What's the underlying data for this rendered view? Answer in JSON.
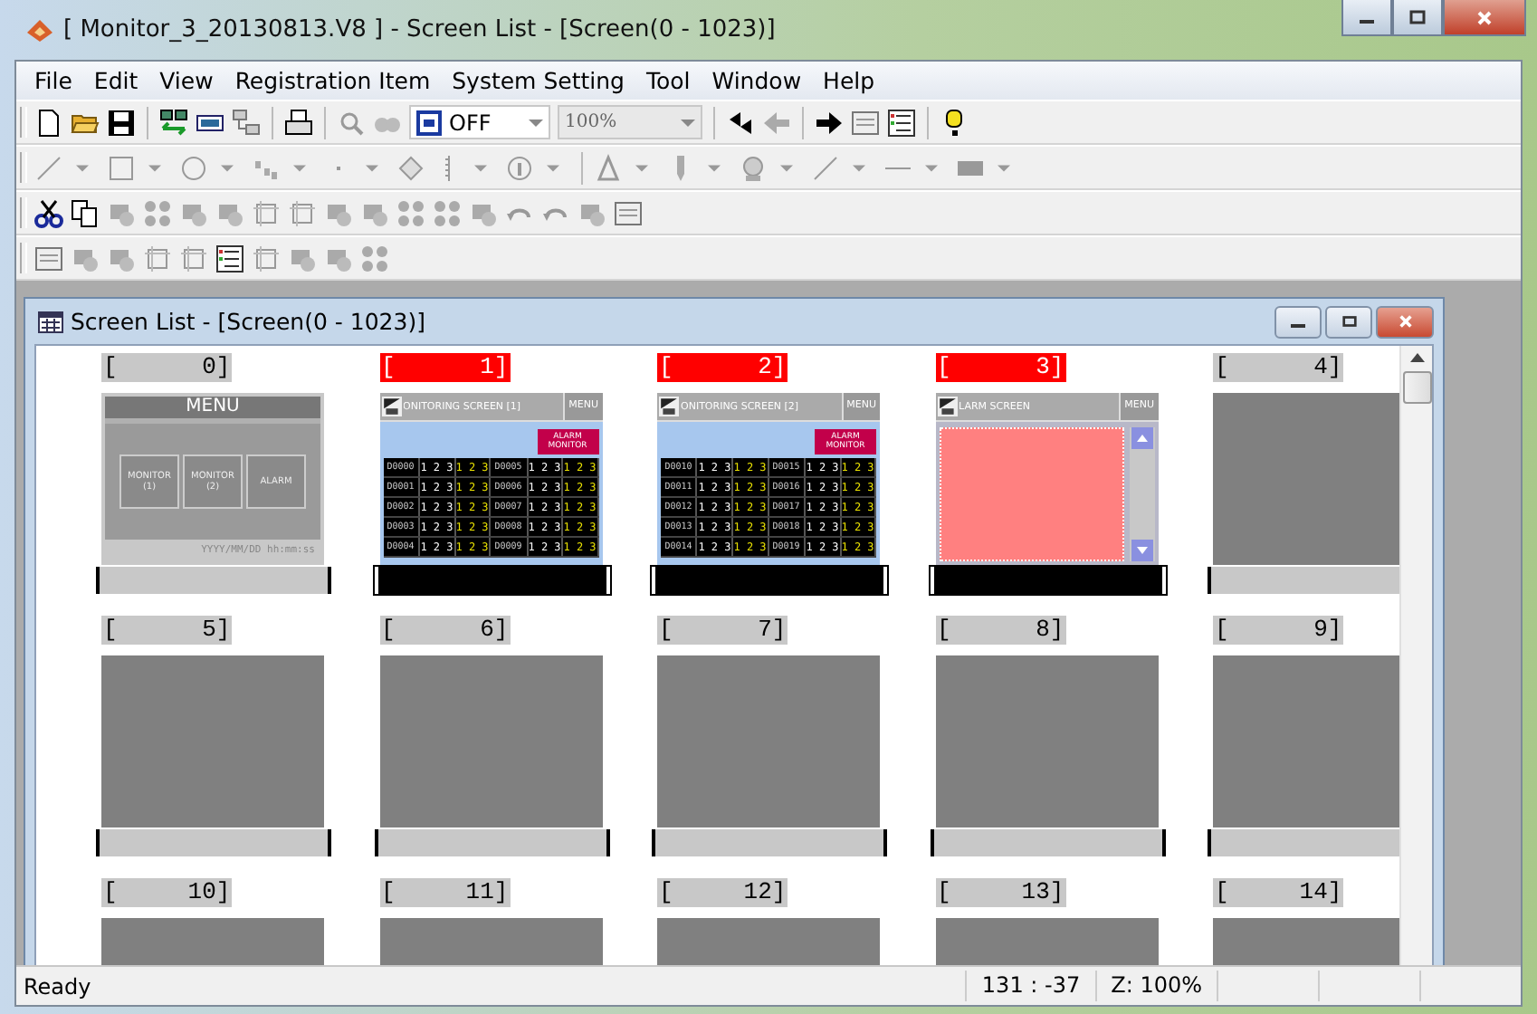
{
  "window": {
    "title": "[ Monitor_3_20130813.V8 ] - Screen List - [Screen(0 - 1023)]"
  },
  "menu": [
    "File",
    "Edit",
    "View",
    "Registration Item",
    "System Setting",
    "Tool",
    "Window",
    "Help"
  ],
  "toolbar": {
    "bit_state": "OFF",
    "zoom": "100%"
  },
  "screen_list": {
    "title": "Screen List - [Screen(0 - 1023)]",
    "screens": [
      {
        "label": "[      0]",
        "selected": false,
        "name_bar": true,
        "kind": "menu",
        "title": "MENU",
        "buttons": [
          "MONITOR (1)",
          "MONITOR (2)",
          "ALARM"
        ],
        "footer": "YYYY/MM/DD hh:mm:ss"
      },
      {
        "label": "[      1]",
        "selected": true,
        "name_bar": true,
        "kind": "monitor",
        "title": "ONITORING SCREEN [1]",
        "menu_button": "MENU",
        "alarm_button": "ALARM MONITOR",
        "rows": [
          [
            "D0000",
            "1 2 3",
            "1 2 3",
            "D0005",
            "1 2 3",
            "1 2 3"
          ],
          [
            "D0001",
            "1 2 3",
            "1 2 3",
            "D0006",
            "1 2 3",
            "1 2 3"
          ],
          [
            "D0002",
            "1 2 3",
            "1 2 3",
            "D0007",
            "1 2 3",
            "1 2 3"
          ],
          [
            "D0003",
            "1 2 3",
            "1 2 3",
            "D0008",
            "1 2 3",
            "1 2 3"
          ],
          [
            "D0004",
            "1 2 3",
            "1 2 3",
            "D0009",
            "1 2 3",
            "1 2 3"
          ]
        ]
      },
      {
        "label": "[      2]",
        "selected": true,
        "name_bar": true,
        "kind": "monitor",
        "title": "ONITORING SCREEN [2]",
        "menu_button": "MENU",
        "alarm_button": "ALARM MONITOR",
        "rows": [
          [
            "D0010",
            "1 2 3",
            "1 2 3",
            "D0015",
            "1 2 3",
            "1 2 3"
          ],
          [
            "D0011",
            "1 2 3",
            "1 2 3",
            "D0016",
            "1 2 3",
            "1 2 3"
          ],
          [
            "D0012",
            "1 2 3",
            "1 2 3",
            "D0017",
            "1 2 3",
            "1 2 3"
          ],
          [
            "D0013",
            "1 2 3",
            "1 2 3",
            "D0018",
            "1 2 3",
            "1 2 3"
          ],
          [
            "D0014",
            "1 2 3",
            "1 2 3",
            "D0019",
            "1 2 3",
            "1 2 3"
          ]
        ]
      },
      {
        "label": "[      3]",
        "selected": true,
        "name_bar": true,
        "kind": "alarm",
        "title": "LARM SCREEN",
        "menu_button": "MENU"
      },
      {
        "label": "[      4]",
        "selected": false,
        "name_bar": true,
        "kind": "blank"
      },
      {
        "label": "[      5]",
        "selected": false,
        "name_bar": true,
        "kind": "blank"
      },
      {
        "label": "[      6]",
        "selected": false,
        "name_bar": true,
        "kind": "blank"
      },
      {
        "label": "[      7]",
        "selected": false,
        "name_bar": true,
        "kind": "blank"
      },
      {
        "label": "[      8]",
        "selected": false,
        "name_bar": true,
        "kind": "blank"
      },
      {
        "label": "[      9]",
        "selected": false,
        "name_bar": true,
        "kind": "blank"
      },
      {
        "label": "[     10]",
        "selected": false,
        "kind": "blank"
      },
      {
        "label": "[     11]",
        "selected": false,
        "kind": "blank"
      },
      {
        "label": "[     12]",
        "selected": false,
        "kind": "blank"
      },
      {
        "label": "[     13]",
        "selected": false,
        "kind": "blank"
      },
      {
        "label": "[     14]",
        "selected": false,
        "kind": "blank"
      }
    ]
  },
  "status_bar": {
    "message": "Ready",
    "position": "131 : -37",
    "zoom": "Z: 100%"
  }
}
